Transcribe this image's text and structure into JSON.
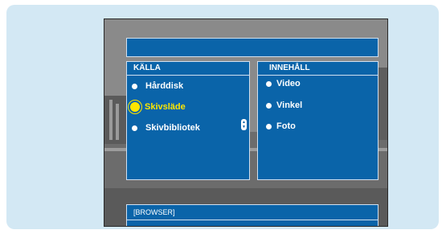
{
  "title_bar": {
    "text": ""
  },
  "source_panel": {
    "header": "KÄLLA",
    "items": [
      {
        "label": "Hårddisk",
        "selected": false
      },
      {
        "label": "Skivsläde",
        "selected": true
      },
      {
        "label": "Skivbibliotek",
        "selected": false
      }
    ]
  },
  "content_panel": {
    "header": "INNEHÅLL",
    "items": [
      {
        "label": "Video"
      },
      {
        "label": "Vinkel"
      },
      {
        "label": "Foto"
      }
    ]
  },
  "bottom_bar": {
    "label": "[BROWSER]"
  },
  "colors": {
    "panel_blue": "#0a64a9",
    "highlight_yellow": "#ffe600",
    "frame_light_blue": "#d3e8f4"
  }
}
